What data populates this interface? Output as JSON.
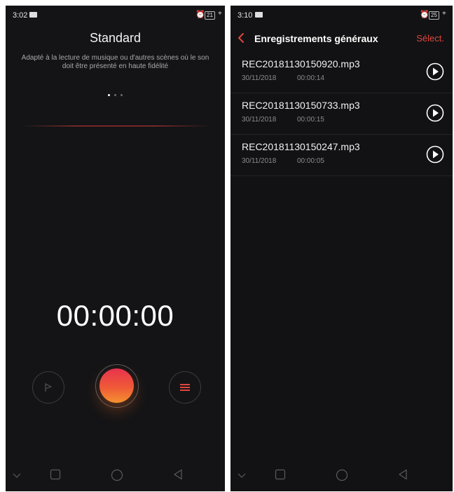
{
  "left": {
    "status": {
      "time": "3:02",
      "battery": "21"
    },
    "mode_title": "Standard",
    "mode_description": "Adapté à la lecture de musique ou d'autres scènes où le son doit être présenté en haute fidélité",
    "timer": "00:00:00",
    "icons": {
      "flag": "flag-icon",
      "record": "record-icon",
      "list": "list-icon"
    }
  },
  "right": {
    "status": {
      "time": "3:10",
      "battery": "25"
    },
    "header": {
      "title": "Enregistrements généraux",
      "select_label": "Sélect."
    },
    "recordings": [
      {
        "name": "REC20181130150920.mp3",
        "date": "30/11/2018",
        "duration": "00:00:14"
      },
      {
        "name": "REC20181130150733.mp3",
        "date": "30/11/2018",
        "duration": "00:00:15"
      },
      {
        "name": "REC20181130150247.mp3",
        "date": "30/11/2018",
        "duration": "00:00:05"
      }
    ]
  },
  "colors": {
    "accent": "#e0463f",
    "background": "#141416",
    "record_gradient_top": "#e8324e",
    "record_gradient_bottom": "#f5922e"
  }
}
